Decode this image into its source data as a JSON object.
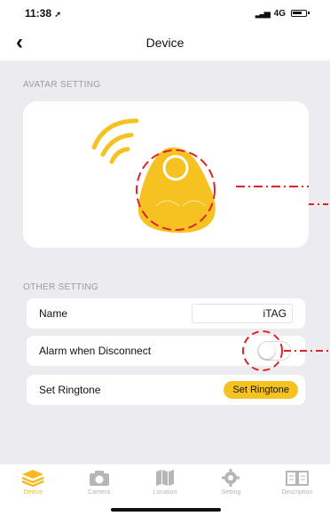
{
  "status_bar": {
    "time": "11:38",
    "network": "4G"
  },
  "nav": {
    "title": "Device"
  },
  "sections": {
    "avatar": "AVATAR SETTING",
    "other": "OTHER SETTING"
  },
  "settings": {
    "name_label": "Name",
    "name_value": "iTAG",
    "alarm_label": "Alarm when Disconnect",
    "alarm_enabled": false,
    "ringtone_label": "Set Ringtone",
    "ringtone_button": "Set Ringtone"
  },
  "tabs": [
    {
      "label": "Device",
      "icon": "layers-icon",
      "active": true
    },
    {
      "label": "Camera",
      "icon": "camera-icon",
      "active": false
    },
    {
      "label": "Location",
      "icon": "map-icon",
      "active": false
    },
    {
      "label": "Setting",
      "icon": "gear-icon",
      "active": false
    },
    {
      "label": "Description",
      "icon": "book-icon",
      "active": false
    }
  ],
  "colors": {
    "accent": "#f6c222",
    "annotation": "#e0222a",
    "background": "#ececf0"
  }
}
